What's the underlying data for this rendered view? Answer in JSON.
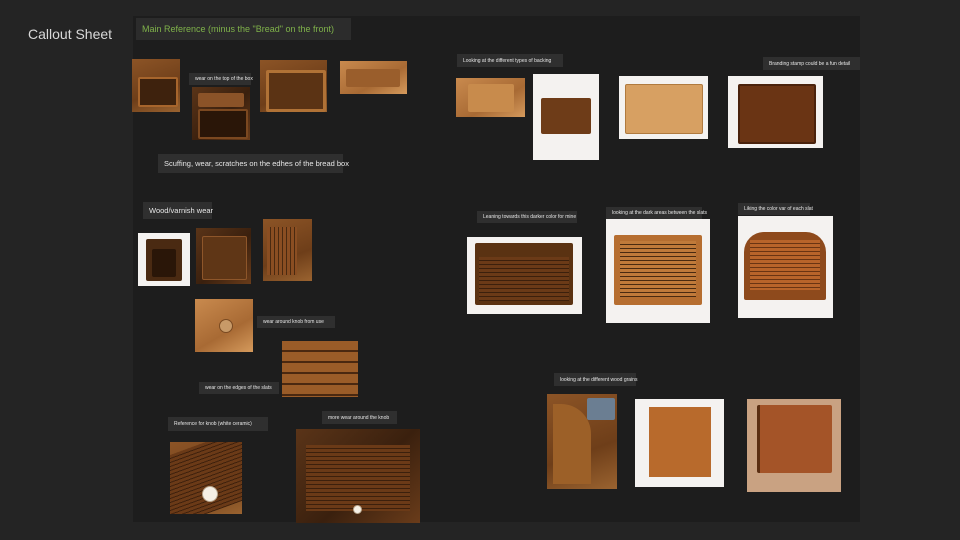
{
  "page": {
    "title": "Callout Sheet"
  },
  "labels": {
    "main_reference": "Main Reference (minus the \"Bread\" on the front)",
    "wear_top": "wear on the top of the box",
    "scuffing": "Scuffing, wear, scratches on the edhes of the bread box",
    "wood_varnish": "Wood/varnish wear",
    "wear_knob": "wear around knob from use",
    "wear_slats": "wear on the edges of the slats",
    "knob_ref": "Reference for knob (white ceramic)",
    "more_wear_knob": "more wear around the knob",
    "backing": "Looking at the different types of backing",
    "branding": "Branding stamp could be a fun detail",
    "leaning": "Leaning towards this darker color for mine",
    "dark_areas": "looking at the dark areas between the slats",
    "color_var": "Liking the color var of each slat",
    "wood_grains": "looking at the different wood grains"
  },
  "images": {
    "main_ref_1": "bread-box-open-photo",
    "main_ref_2": "bread-box-top-photo",
    "main_ref_3": "bread-box-front-photo",
    "main_ref_4": "bread-box-lid-photo",
    "varnish_1": "small-cabinet-photo",
    "varnish_2": "wood-box-photo",
    "varnish_3": "wood-closeup-photo",
    "knob_wear": "knob-closeup-photo",
    "slat_edges": "slat-edges-photo",
    "ceramic_knob": "ceramic-knob-photo",
    "roll_top_knob": "roll-top-box-photo",
    "backing_1": "light-box-photo",
    "backing_2": "white-bg-box-photo",
    "backing_3": "pale-wood-box-photo",
    "branding_box": "dark-box-stamp-photo",
    "dark_roll_top": "dark-roll-top-photo",
    "slat_roll_top": "slat-roll-top-photo",
    "color_roll_top": "color-var-roll-top-photo",
    "grain_1": "grain-closeup-photo",
    "grain_2": "side-panel-photo",
    "grain_3": "side-profile-photo"
  }
}
